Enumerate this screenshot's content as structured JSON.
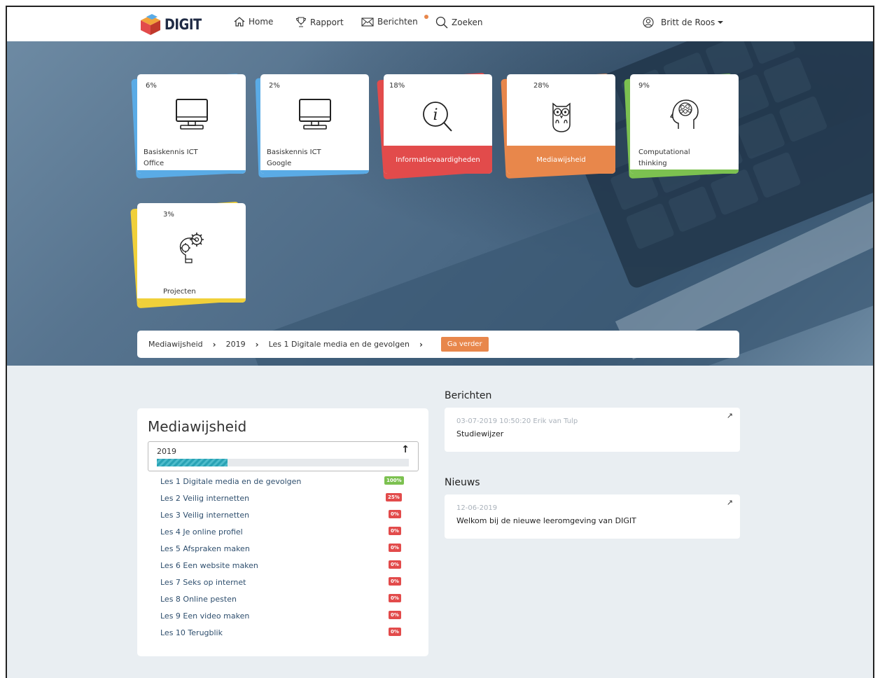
{
  "brand": {
    "name": "DIGIT",
    "accent": "#e8874b"
  },
  "nav": {
    "home": "Home",
    "report": "Rapport",
    "messages": "Berichten",
    "search": "Zoeken",
    "user": "Britt de Roos"
  },
  "cards": [
    {
      "pct": "6%",
      "label1": "Basiskennis ICT",
      "label2": "Office",
      "color": "#5aabe6",
      "icon": "monitor-icon"
    },
    {
      "pct": "2%",
      "label1": "Basiskennis ICT",
      "label2": "Google",
      "color": "#5aabe6",
      "icon": "monitor-icon"
    },
    {
      "pct": "18%",
      "label1": "Informatievaardigheden",
      "label2": "",
      "color": "#e24b4b",
      "icon": "info-search-icon"
    },
    {
      "pct": "28%",
      "label1": "Mediawijsheid",
      "label2": "",
      "color": "#e8874b",
      "icon": "owl-icon"
    },
    {
      "pct": "9%",
      "label1": "Computational",
      "label2": "thinking",
      "color": "#7cc150",
      "icon": "brain-icon"
    },
    {
      "pct": "3%",
      "label1": "Projecten",
      "label2": "",
      "color": "#f0d03a",
      "icon": "gear-bulb-icon"
    }
  ],
  "breadcrumb": {
    "items": [
      "Mediawijsheid",
      "2019",
      "Les 1 Digitale media en de gevolgen"
    ],
    "button": "Ga verder"
  },
  "panel": {
    "title": "Mediawijsheid",
    "year": "2019",
    "progress": 0.28,
    "lessons": [
      {
        "name": "Les 1 Digitale media en de gevolgen",
        "badge": "100%",
        "status": "green"
      },
      {
        "name": "Les 2 Veilig internetten",
        "badge": "25%",
        "status": "red"
      },
      {
        "name": "Les 3 Veilig internetten",
        "badge": "0%",
        "status": "red"
      },
      {
        "name": "Les 4 Je online profiel",
        "badge": "0%",
        "status": "red"
      },
      {
        "name": "Les 5 Afspraken maken",
        "badge": "0%",
        "status": "red"
      },
      {
        "name": "Les 6 Een website maken",
        "badge": "0%",
        "status": "red"
      },
      {
        "name": "Les 7 Seks op internet",
        "badge": "0%",
        "status": "red"
      },
      {
        "name": "Les 8 Online pesten",
        "badge": "0%",
        "status": "red"
      },
      {
        "name": "Les 9 Een video maken",
        "badge": "0%",
        "status": "red"
      },
      {
        "name": "Les 10 Terugblik",
        "badge": "0%",
        "status": "red"
      }
    ]
  },
  "messages": {
    "title": "Berichten",
    "meta": "03-07-2019 10:50:20 Erik van Tulp",
    "text": "Studiewijzer"
  },
  "news": {
    "title": "Nieuws",
    "meta": "12-06-2019",
    "text": "Welkom bij de nieuwe leeromgeving van DIGIT"
  }
}
